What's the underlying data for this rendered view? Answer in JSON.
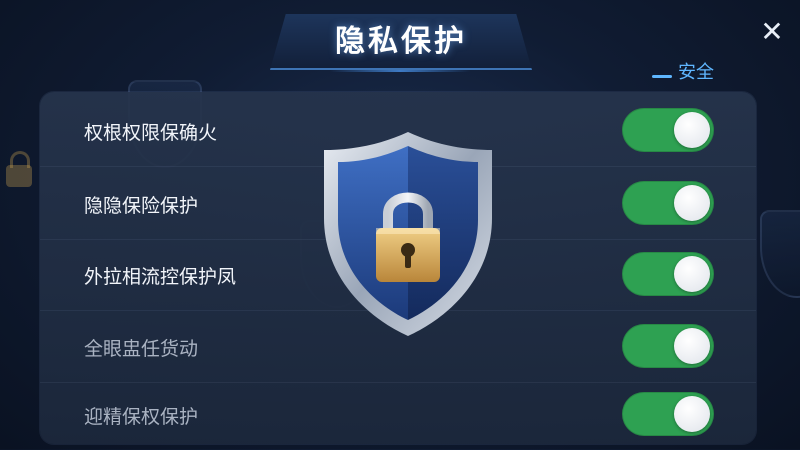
{
  "header": {
    "title": "隐私保护",
    "close_icon": "close-icon",
    "tag_label": "安全"
  },
  "settings": [
    {
      "label": "权根权限保确火",
      "enabled": true
    },
    {
      "label": "隐隐保险保护",
      "enabled": true
    },
    {
      "label": "外拉相流控保护凤",
      "enabled": true
    },
    {
      "label": "全眼盅任货动",
      "enabled": true
    },
    {
      "label": "迎精保权保护",
      "enabled": true
    }
  ],
  "colors": {
    "toggle_on": "#2ea152",
    "accent": "#5fb6ff",
    "background": "#101c33"
  },
  "center_graphic": {
    "icon": "shield-lock-icon"
  }
}
